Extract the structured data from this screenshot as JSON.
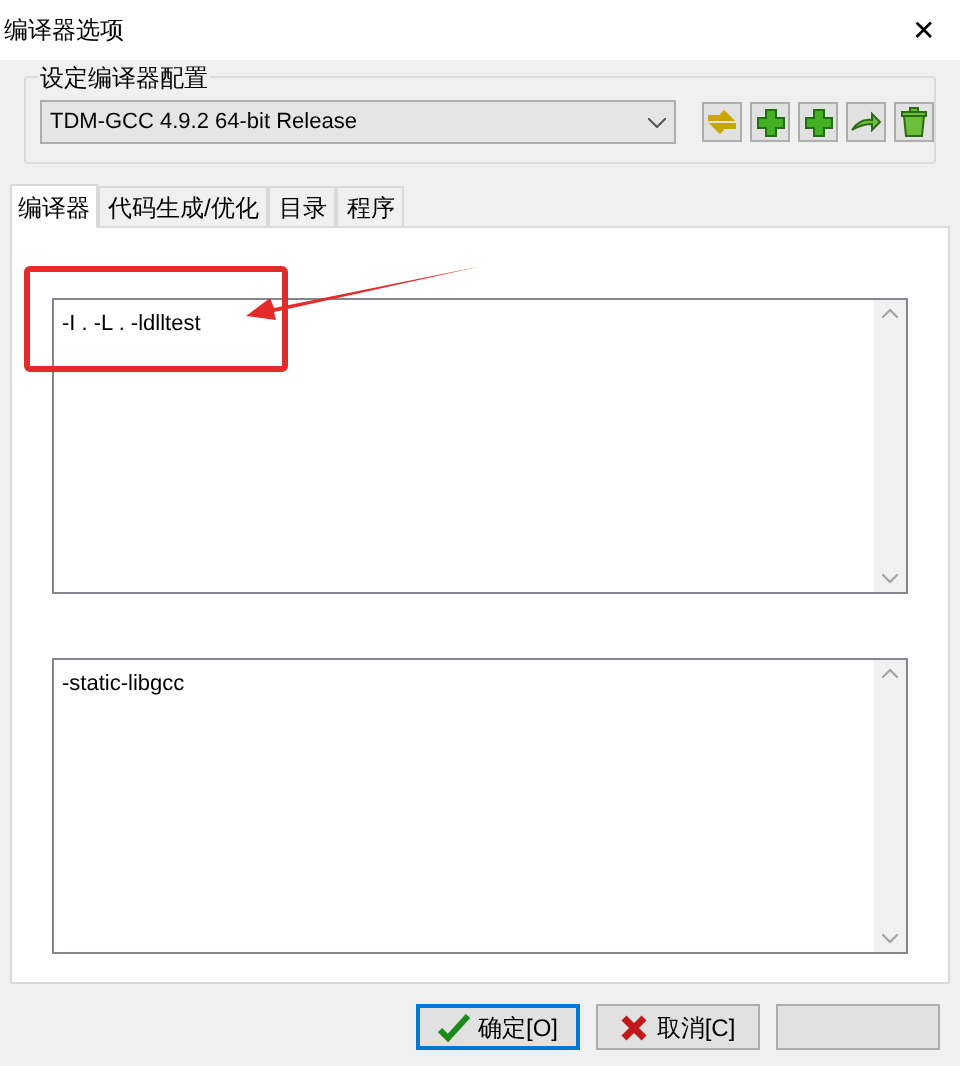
{
  "window": {
    "title": "编译器选项",
    "close": "✕"
  },
  "config": {
    "label": "设定编译器配置",
    "value": "TDM-GCC 4.9.2 64-bit Release"
  },
  "tabs": [
    {
      "label": "编译器",
      "selected": true
    },
    {
      "label": "代码生成/优化",
      "selected": false
    },
    {
      "label": "目录",
      "selected": false
    },
    {
      "label": "程序",
      "selected": false
    }
  ],
  "compile_options": "-I . -L . -ldlltest",
  "link_options": "-static-libgcc",
  "buttons": [
    {
      "label": "确定[O]",
      "kind": "ok"
    },
    {
      "label": "取消[C]",
      "kind": "cancel"
    },
    {
      "kind": "blank"
    }
  ]
}
